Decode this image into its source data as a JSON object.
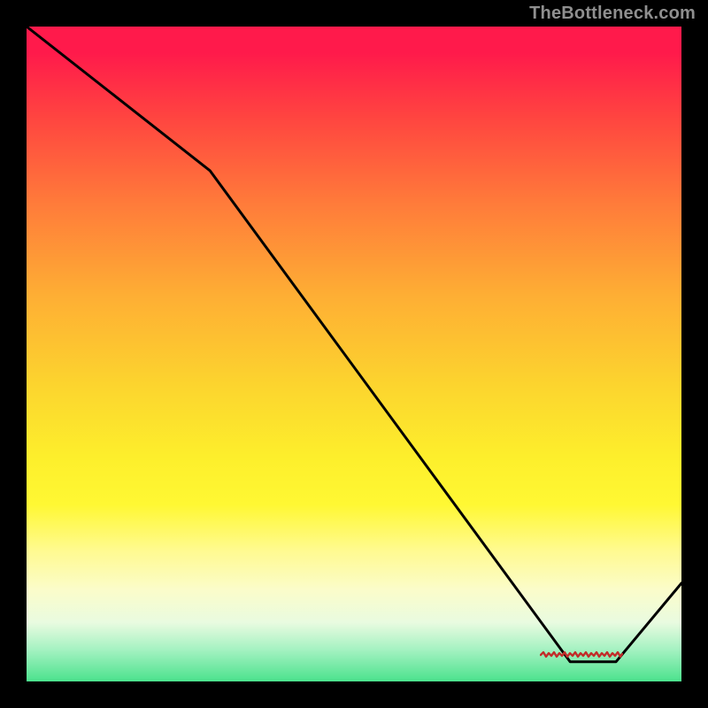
{
  "watermark": {
    "text": "TheBottleneck.com"
  },
  "colors": {
    "curve": "#000000",
    "scribble": "#c12d2a",
    "frame_bg": "#000000"
  },
  "chart_data": {
    "type": "line",
    "title": "",
    "xlabel": "",
    "ylabel": "",
    "xlim": [
      0,
      100
    ],
    "ylim": [
      0,
      100
    ],
    "grid": false,
    "series": [
      {
        "name": "bottleneck-curve",
        "x": [
          0,
          28,
          83,
          90,
          100
        ],
        "values": [
          100,
          78,
          3,
          3,
          15
        ]
      }
    ],
    "annotations": [
      {
        "text": "illegible-scribble",
        "x": 85,
        "y": 4,
        "color": "#c12d2a"
      }
    ]
  }
}
